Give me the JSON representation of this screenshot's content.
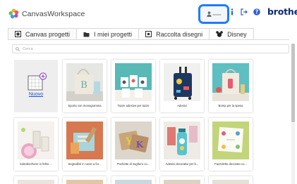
{
  "app": {
    "title": "CanvasWorkspace",
    "brand": "brother"
  },
  "user": {
    "name": "xxxxxx"
  },
  "tabs": [
    {
      "label": "Canvas progetti",
      "icon": "canvas-icon",
      "active": true
    },
    {
      "label": "I miei progetti",
      "icon": "folder-icon",
      "active": false
    },
    {
      "label": "Raccolta disegni",
      "icon": "image-icon",
      "active": false
    },
    {
      "label": "Disney",
      "icon": "mickey-icon",
      "active": false
    }
  ],
  "search": {
    "placeholder": "Cerca"
  },
  "new_project": {
    "label": "Nuovo"
  },
  "projects": [
    {
      "title": "Sporta con monogramma",
      "theme": "tote-bag"
    },
    {
      "title": "Tazze adesive per tazze",
      "theme": "mugs"
    },
    {
      "title": "Adesivi",
      "theme": "suitcase"
    },
    {
      "title": "Borsa per la spesa",
      "theme": "shopping-bag"
    },
    {
      "title": "Sottobicchiere in feltro ...",
      "theme": "coasters"
    },
    {
      "title": "Segnalibri in cuoio a for...",
      "theme": "bookmarks"
    },
    {
      "title": "Pochette di sughero co...",
      "theme": "cork-pouch"
    },
    {
      "title": "Adesivi decorativi per b...",
      "theme": "bottle"
    },
    {
      "title": "Fazzoletto decorato co...",
      "theme": "handkerchief"
    }
  ],
  "colors": {
    "accent": "#1e7cff",
    "brand": "#0b2a7d",
    "link": "#1e4fcf"
  }
}
